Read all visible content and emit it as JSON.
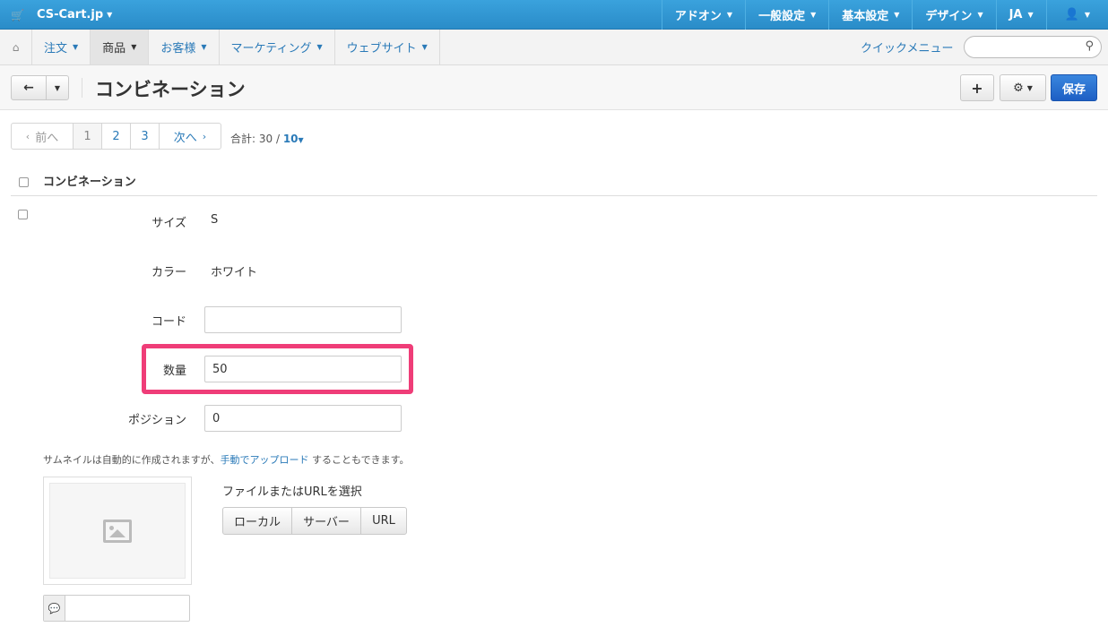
{
  "topbar": {
    "brand": "CS-Cart.jp",
    "cart_icon": "cart-icon",
    "items": [
      {
        "label": "アドオン"
      },
      {
        "label": "一般設定"
      },
      {
        "label": "基本設定"
      },
      {
        "label": "デザイン"
      },
      {
        "label": "JA"
      }
    ],
    "user_icon": "user-icon",
    "color": "#2a8cc8"
  },
  "subnav": {
    "home_icon": "home-icon",
    "items": [
      {
        "label": "注文"
      },
      {
        "label": "商品"
      },
      {
        "label": "お客様"
      },
      {
        "label": "マーケティング"
      },
      {
        "label": "ウェブサイト"
      }
    ],
    "active_index": 1,
    "quick_menu": "クイックメニュー",
    "search_placeholder": ""
  },
  "titlebar": {
    "title": "コンビネーション",
    "save_label": "保存",
    "save_color": "#1e5fc4"
  },
  "pagination": {
    "prev": "前へ",
    "pages": [
      "1",
      "2",
      "3"
    ],
    "current": "1",
    "next": "次へ",
    "total_prefix": "合計: 30 /",
    "limit": "10"
  },
  "table": {
    "header": "コンビネーション"
  },
  "combination": {
    "size_label": "サイズ",
    "size_value": "S",
    "color_label": "カラー",
    "color_value": "ホワイト",
    "code_label": "コード",
    "code_value": "",
    "qty_label": "数量",
    "qty_value": "50",
    "position_label": "ポジション",
    "position_value": "0",
    "highlight_color": "#ef3d78"
  },
  "thumbnail": {
    "note_before": "サムネイルは自動的に作成されますが、",
    "note_link": "手動でアップロード",
    "note_after": " することもできます。",
    "file_prompt": "ファイルまたはURLを選択",
    "buttons": [
      {
        "label": "ローカル"
      },
      {
        "label": "サーバー"
      },
      {
        "label": "URL"
      }
    ],
    "alt_value": ""
  }
}
